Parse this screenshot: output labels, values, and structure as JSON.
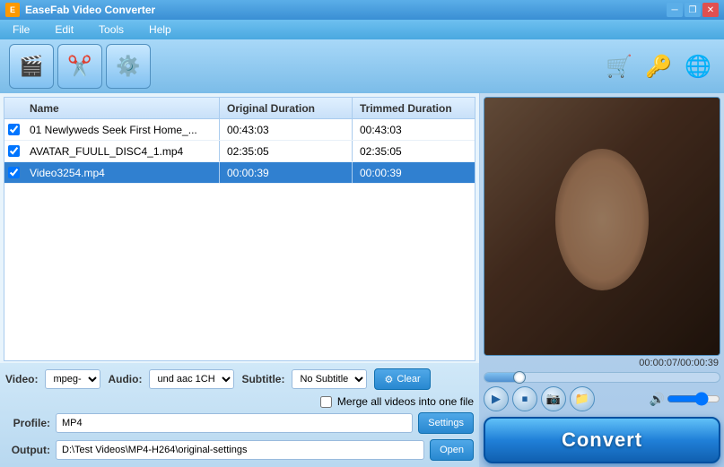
{
  "titlebar": {
    "title": "EaseFab Video Converter",
    "icon": "E"
  },
  "menubar": {
    "items": [
      {
        "label": "File"
      },
      {
        "label": "Edit"
      },
      {
        "label": "Tools"
      },
      {
        "label": "Help"
      }
    ]
  },
  "toolbar": {
    "buttons": [
      {
        "label": "Add Video",
        "icon": "🎬"
      },
      {
        "label": "Edit",
        "icon": "✂️"
      },
      {
        "label": "Settings",
        "icon": "⚙️"
      }
    ],
    "right_buttons": [
      {
        "label": "Shopping",
        "icon": "🛒"
      },
      {
        "label": "Key",
        "icon": "🔑"
      },
      {
        "label": "Help",
        "icon": "🌐"
      }
    ]
  },
  "file_list": {
    "columns": [
      "Name",
      "Original Duration",
      "Trimmed Duration"
    ],
    "rows": [
      {
        "checked": true,
        "name": "01 Newlyweds Seek First Home_...",
        "original": "00:43:03",
        "trimmed": "00:43:03",
        "selected": false
      },
      {
        "checked": true,
        "name": "AVATAR_FUULL_DISC4_1.mp4",
        "original": "02:35:05",
        "trimmed": "02:35:05",
        "selected": false
      },
      {
        "checked": true,
        "name": "Video3254.mp4",
        "original": "00:00:39",
        "trimmed": "00:00:39",
        "selected": true
      }
    ]
  },
  "controls": {
    "video_label": "Video:",
    "video_value": "mpeg-",
    "audio_label": "Audio:",
    "audio_value": "und aac 1CH",
    "subtitle_label": "Subtitle:",
    "subtitle_value": "No Subtitle",
    "clear_label": "Clear",
    "merge_label": "Merge all videos into one file",
    "profile_label": "Profile:",
    "profile_value": "MP4",
    "settings_label": "Settings",
    "output_label": "Output:",
    "output_value": "D:\\Test Videos\\MP4-H264\\original-settings",
    "open_label": "Open"
  },
  "player": {
    "time_display": "00:00:07/00:00:39",
    "play_btn": "▶",
    "stop_btn": "⏹",
    "screenshot_btn": "📷",
    "folder_btn": "📁",
    "volume_btn": "🔊"
  },
  "convert_btn": "Convert"
}
